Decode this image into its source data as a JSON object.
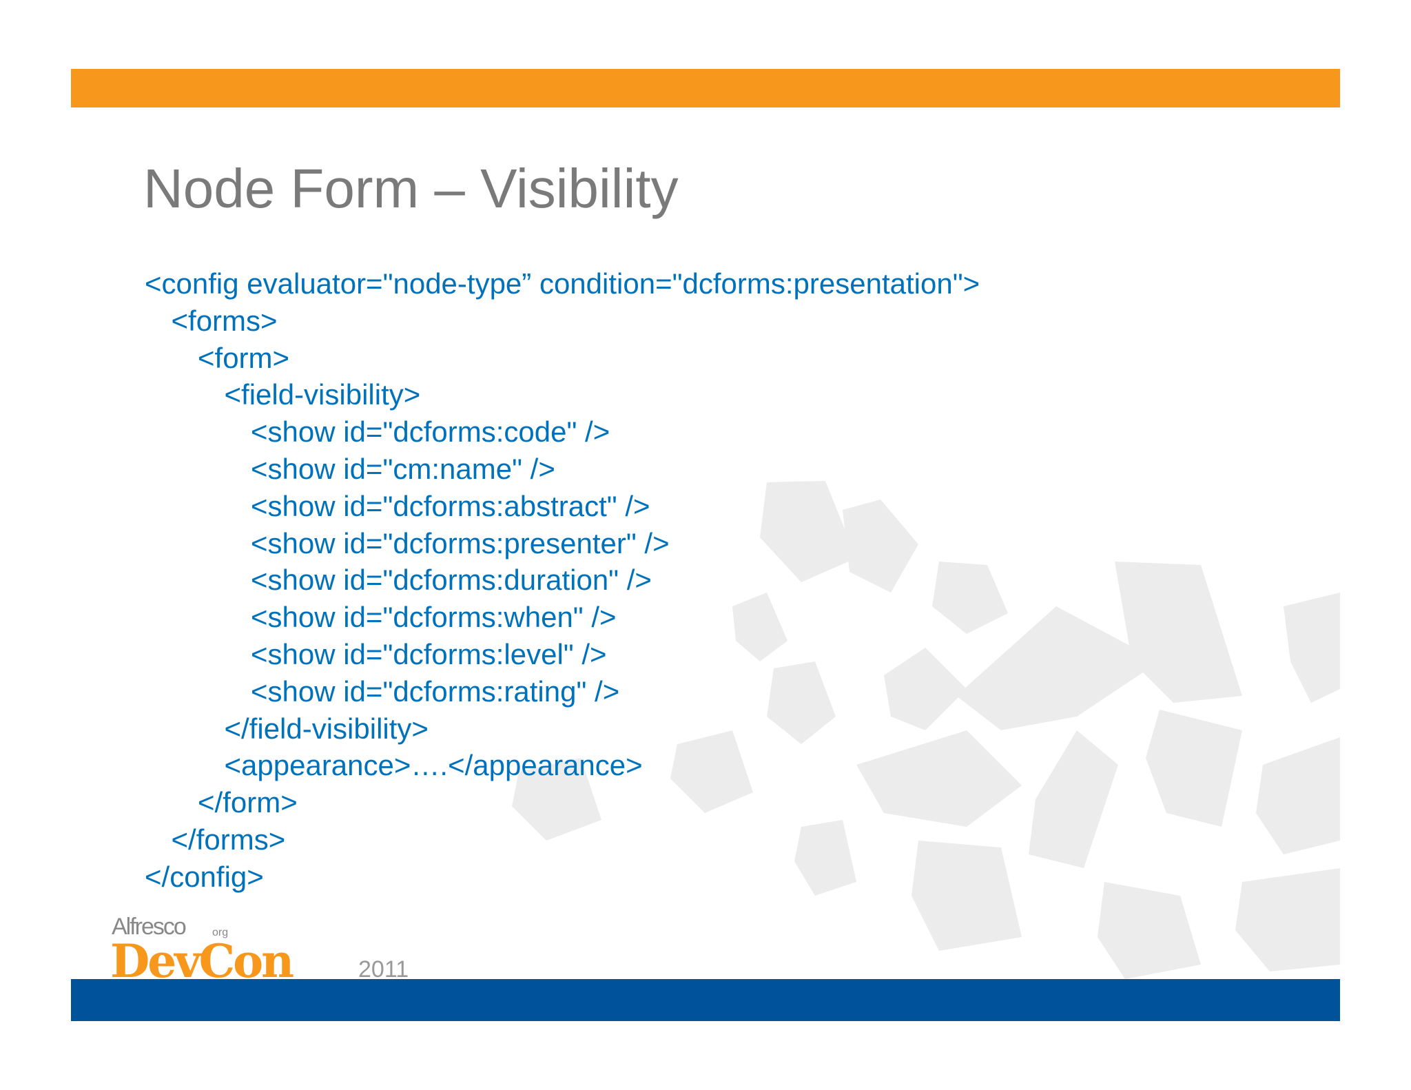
{
  "slide": {
    "title": "Node Form – Visibility",
    "code_lines": [
      {
        "indent": 0,
        "text": "<config evaluator=\"node-type” condition=\"dcforms:presentation\">"
      },
      {
        "indent": 1,
        "text": "<forms>"
      },
      {
        "indent": 2,
        "text": "<form>"
      },
      {
        "indent": 3,
        "text": "<field-visibility>"
      },
      {
        "indent": 4,
        "text": "<show id=\"dcforms:code\" />"
      },
      {
        "indent": 4,
        "text": "<show id=\"cm:name\" />"
      },
      {
        "indent": 4,
        "text": "<show id=\"dcforms:abstract\" />"
      },
      {
        "indent": 4,
        "text": "<show id=\"dcforms:presenter\" />"
      },
      {
        "indent": 4,
        "text": "<show id=\"dcforms:duration\" />"
      },
      {
        "indent": 4,
        "text": "<show id=\"dcforms:when\" />"
      },
      {
        "indent": 4,
        "text": "<show id=\"dcforms:level\" />"
      },
      {
        "indent": 4,
        "text": "<show id=\"dcforms:rating\" />"
      },
      {
        "indent": 3,
        "text": "</field-visibility>"
      },
      {
        "indent": 3,
        "text": "<appearance>….</appearance>"
      },
      {
        "indent": 2,
        "text": "</form>"
      },
      {
        "indent": 1,
        "text": "</forms>"
      },
      {
        "indent": 0,
        "text": "</config>"
      }
    ]
  },
  "logo": {
    "brand": "Alfresco",
    "brand_suffix": "org",
    "event": "DevCon",
    "year": "2011"
  },
  "colors": {
    "top_bar": "#f7981d",
    "bottom_bar": "#00529b",
    "title": "#7a7a7a",
    "code": "#0072bc",
    "logo_orange": "#f7981d"
  }
}
